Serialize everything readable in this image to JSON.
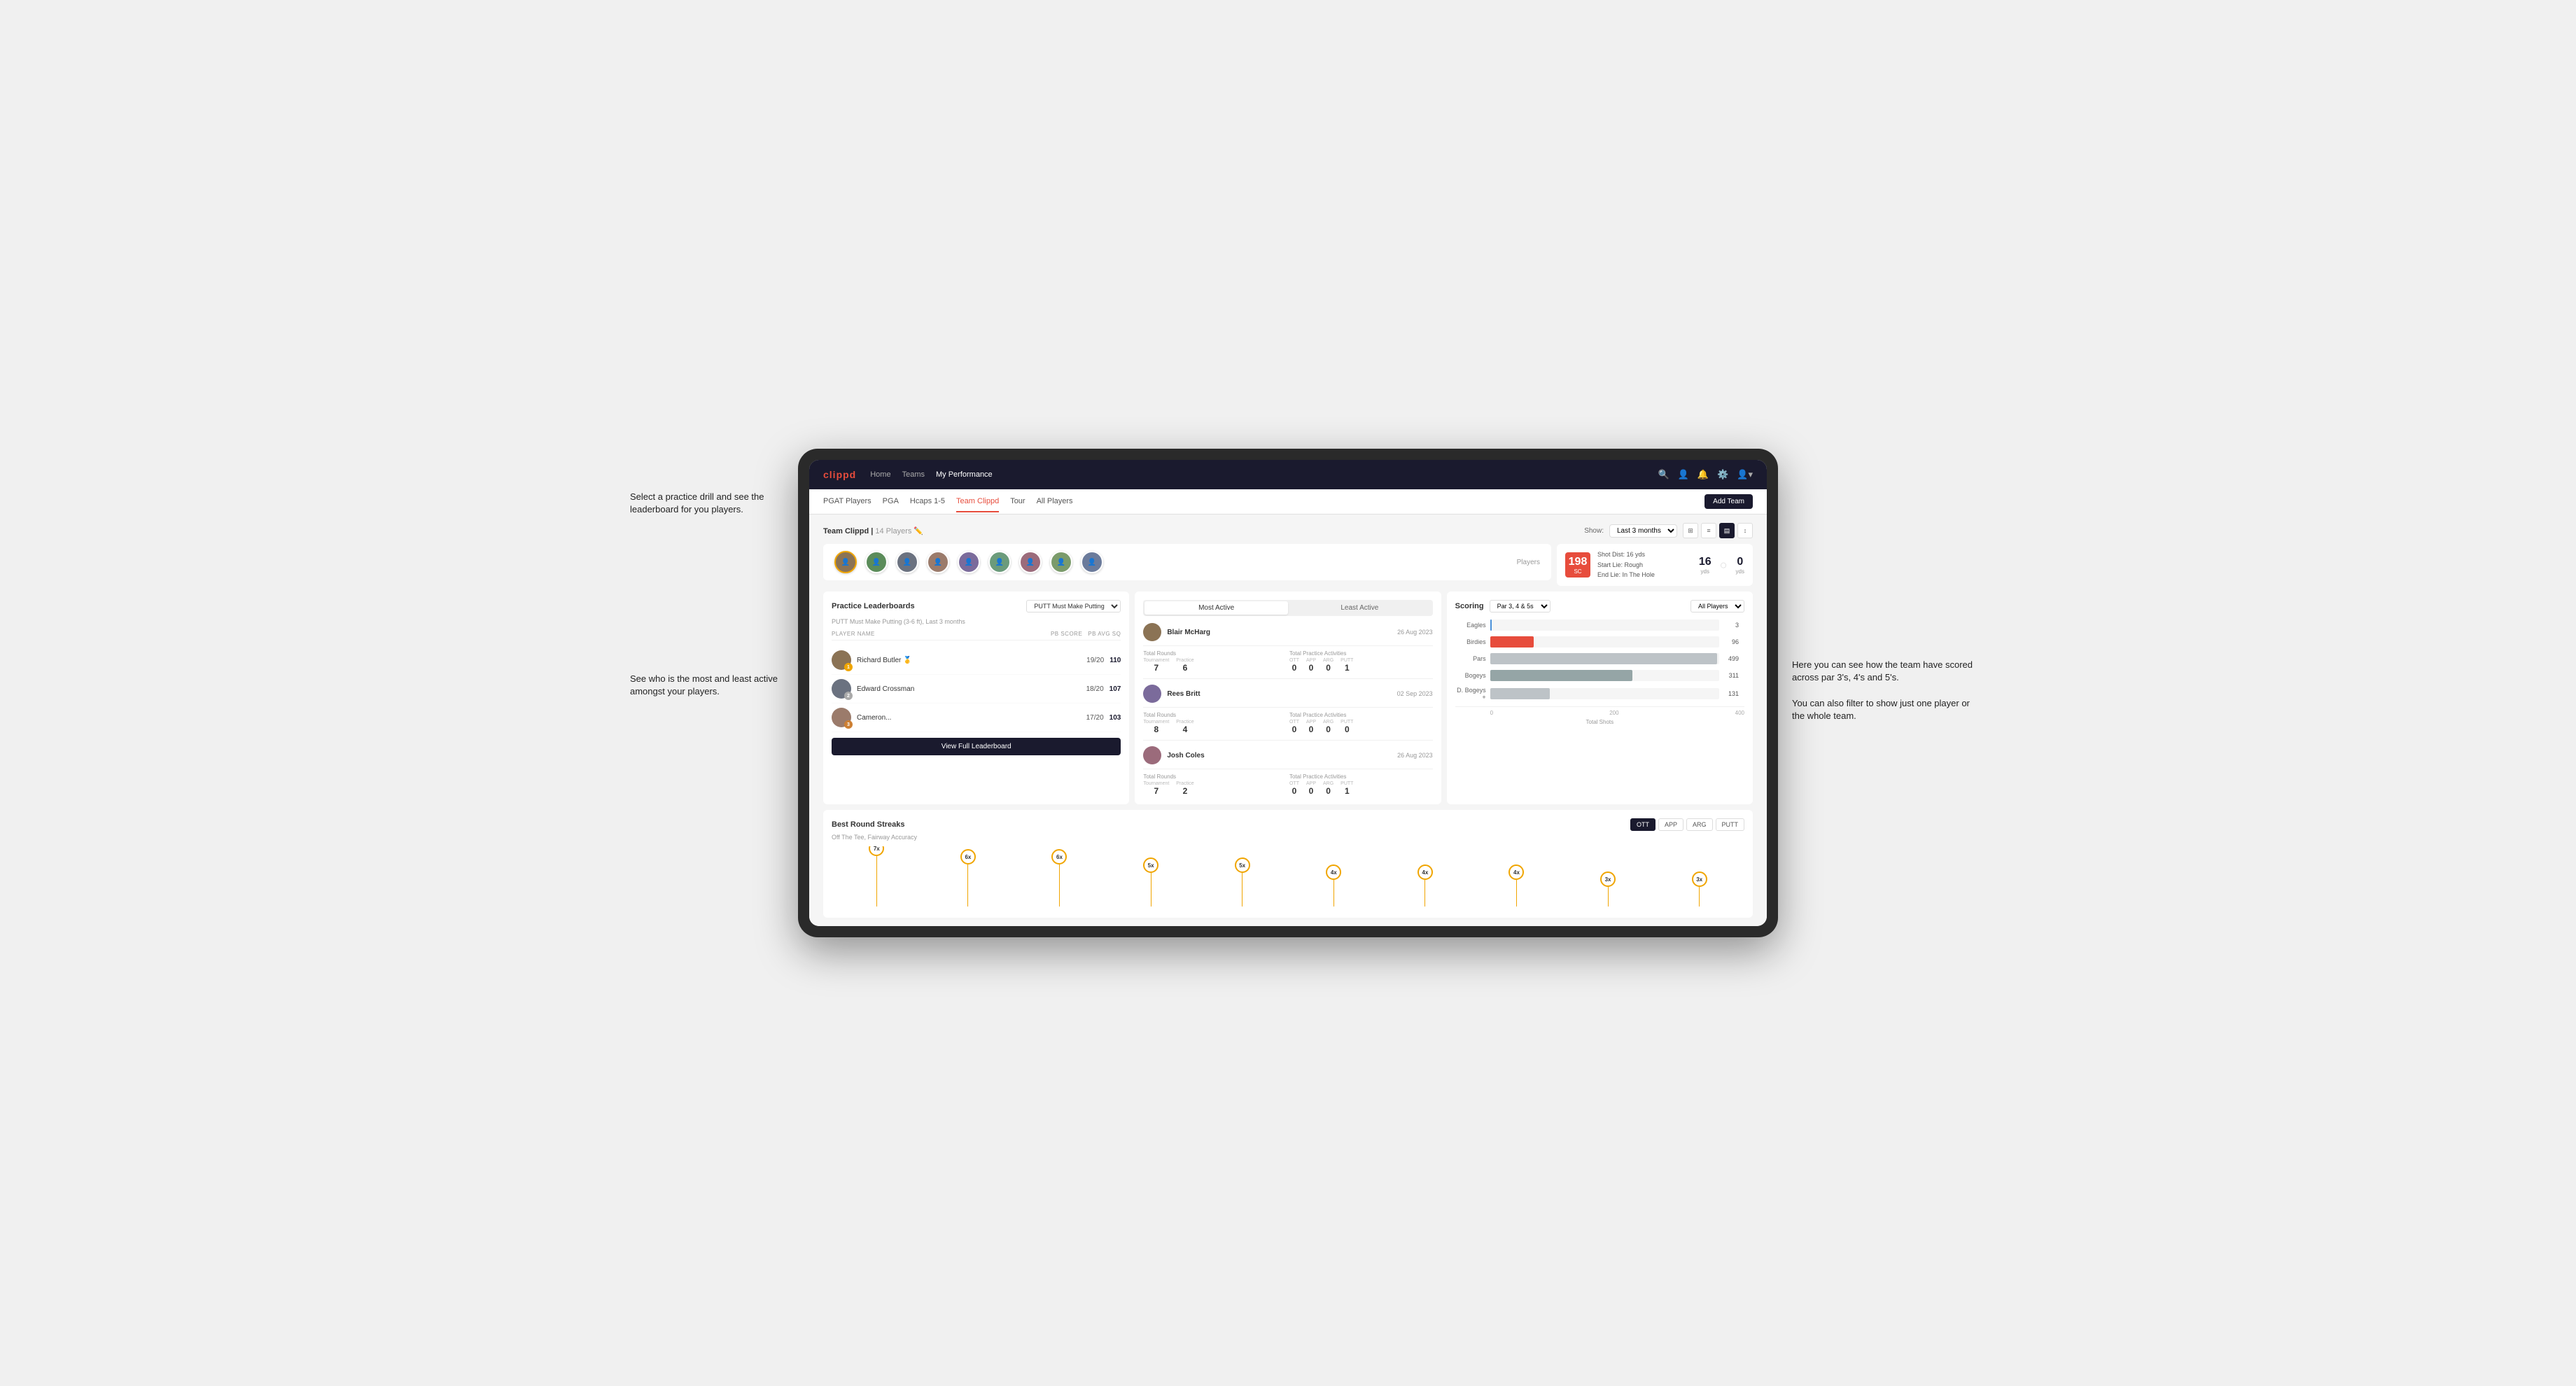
{
  "annotations": {
    "text1": "Select a practice drill and see the leaderboard for you players.",
    "text2": "See who is the most and least active amongst your players.",
    "text3": "Here you can see how the team have scored across par 3's, 4's and 5's.",
    "text4": "You can also filter to show just one player or the whole team."
  },
  "nav": {
    "logo": "clippd",
    "links": [
      "Home",
      "Teams",
      "My Performance"
    ],
    "icons": [
      "search",
      "person",
      "bell",
      "settings",
      "profile"
    ]
  },
  "subnav": {
    "links": [
      "PGAT Players",
      "PGA",
      "Hcaps 1-5",
      "Team Clippd",
      "Tour",
      "All Players"
    ],
    "active": "Team Clippd",
    "add_team_label": "Add Team"
  },
  "team_header": {
    "title": "Team Clippd",
    "count": "14 Players",
    "show_label": "Show:",
    "show_value": "Last 3 months",
    "players_label": "Players"
  },
  "shot_info": {
    "badge_num": "198",
    "badge_unit": "SC",
    "line1": "Shot Dist: 16 yds",
    "line2": "Start Lie: Rough",
    "line3": "End Lie: In The Hole",
    "metric1": "16",
    "metric1_unit": "yds",
    "metric2": "0",
    "metric2_unit": "yds"
  },
  "practice_leaderboards": {
    "title": "Practice Leaderboards",
    "drill": "PUTT Must Make Putting",
    "subtitle": "PUTT Must Make Putting (3-6 ft), Last 3 months",
    "cols": [
      "PLAYER NAME",
      "PB SCORE",
      "PB AVG SQ"
    ],
    "players": [
      {
        "rank": 1,
        "badge": "gold",
        "name": "Richard Butler",
        "score": "19/20",
        "avg": "110"
      },
      {
        "rank": 2,
        "badge": "silver",
        "name": "Edward Crossman",
        "score": "18/20",
        "avg": "107"
      },
      {
        "rank": 3,
        "badge": "bronze",
        "name": "Cameron...",
        "score": "17/20",
        "avg": "103"
      }
    ],
    "view_full_label": "View Full Leaderboard"
  },
  "activity": {
    "tabs": [
      "Most Active",
      "Least Active"
    ],
    "active_tab": "Most Active",
    "players": [
      {
        "name": "Blair McHarg",
        "date": "26 Aug 2023",
        "total_rounds_label": "Total Rounds",
        "tournament_label": "Tournament",
        "practice_label": "Practice",
        "tournament_val": "7",
        "practice_val": "6",
        "total_practice_label": "Total Practice Activities",
        "ott": "0",
        "app": "0",
        "arg": "0",
        "putt": "1"
      },
      {
        "name": "Rees Britt",
        "date": "02 Sep 2023",
        "tournament_val": "8",
        "practice_val": "4",
        "ott": "0",
        "app": "0",
        "arg": "0",
        "putt": "0"
      },
      {
        "name": "Josh Coles",
        "date": "26 Aug 2023",
        "tournament_val": "7",
        "practice_val": "2",
        "ott": "0",
        "app": "0",
        "arg": "0",
        "putt": "1"
      }
    ]
  },
  "scoring": {
    "title": "Scoring",
    "filter": "Par 3, 4 & 5s",
    "player_filter": "All Players",
    "bars": [
      {
        "label": "Eagles",
        "value": 3,
        "max": 500,
        "type": "eagles"
      },
      {
        "label": "Birdies",
        "value": 96,
        "max": 500,
        "type": "birdies"
      },
      {
        "label": "Pars",
        "value": 499,
        "max": 500,
        "type": "pars"
      },
      {
        "label": "Bogeys",
        "value": 311,
        "max": 500,
        "type": "bogeys"
      },
      {
        "label": "D. Bogeys +",
        "value": 131,
        "max": 500,
        "type": "doubles"
      }
    ],
    "axis_labels": [
      "0",
      "200",
      "400"
    ],
    "x_label": "Total Shots"
  },
  "streaks": {
    "title": "Best Round Streaks",
    "tabs": [
      "OTT",
      "APP",
      "ARG",
      "PUTT"
    ],
    "active_tab": "OTT",
    "subtitle": "Off The Tee, Fairway Accuracy",
    "points": [
      {
        "label": "7x",
        "height": 72
      },
      {
        "label": "6x",
        "height": 60
      },
      {
        "label": "6x",
        "height": 60
      },
      {
        "label": "5x",
        "height": 48
      },
      {
        "label": "5x",
        "height": 48
      },
      {
        "label": "4x",
        "height": 38
      },
      {
        "label": "4x",
        "height": 38
      },
      {
        "label": "4x",
        "height": 38
      },
      {
        "label": "3x",
        "height": 28
      },
      {
        "label": "3x",
        "height": 28
      }
    ]
  }
}
